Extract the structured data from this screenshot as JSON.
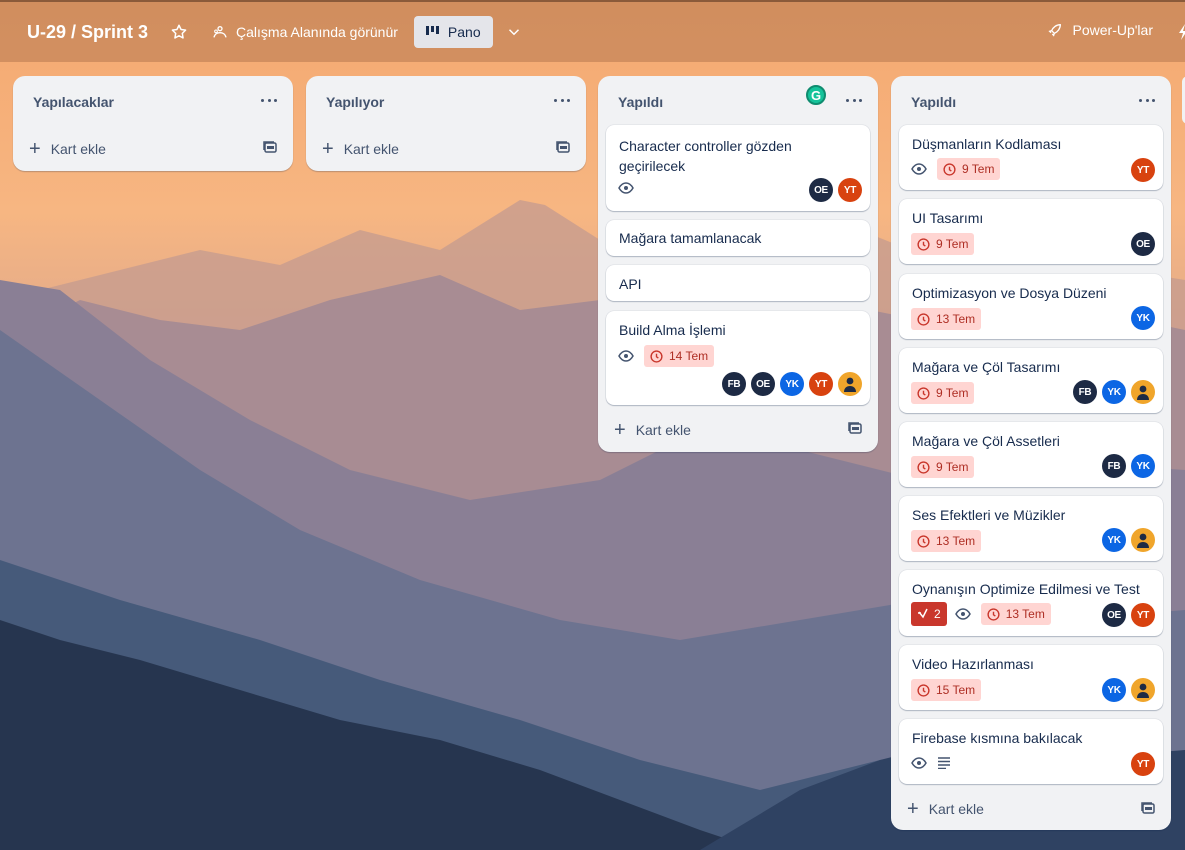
{
  "header": {
    "board_title": "U-29 / Sprint 3",
    "visibility_label": "Çalışma Alanında görünür",
    "view_label": "Pano",
    "powerups_label": "Power-Up'lar"
  },
  "add_card_label": "Kart ekle",
  "colors": {
    "due_bg": "#ffd5d2",
    "due_text": "#ae2e24",
    "checklist_bg": "#c9372c",
    "avatar_dark": "#1d2a44",
    "avatar_red": "#d8420f",
    "avatar_blue": "#0c66e4",
    "avatar_orange": "#f0a52b"
  },
  "lists": [
    {
      "title": "Yapılacaklar",
      "cards": []
    },
    {
      "title": "Yapılıyor",
      "cards": []
    },
    {
      "title": "Yapıldı",
      "grammarly_badge": "G",
      "cards": [
        {
          "title": "Character controller gözden geçirilecek",
          "watch": true,
          "members": [
            "OE",
            "YT"
          ]
        },
        {
          "title": "Mağara tamamlanacak"
        },
        {
          "title": "API"
        },
        {
          "title": "Build Alma İşlemi",
          "watch": true,
          "due": "14 Tem",
          "members": [
            "FB",
            "OE",
            "YK",
            "YT",
            "user-avatar"
          ]
        }
      ]
    },
    {
      "title": "Yapıldı",
      "cards": [
        {
          "title": "Düşmanların Kodlaması",
          "watch": true,
          "due": "9 Tem",
          "members": [
            "YT"
          ]
        },
        {
          "title": "UI Tasarımı",
          "due": "9 Tem",
          "members": [
            "OE"
          ]
        },
        {
          "title": "Optimizasyon ve Dosya Düzeni",
          "due": "13 Tem",
          "members": [
            "YK"
          ]
        },
        {
          "title": "Mağara ve Çöl Tasarımı",
          "due": "9 Tem",
          "members": [
            "FB",
            "YK",
            "user-avatar"
          ]
        },
        {
          "title": "Mağara ve Çöl Assetleri",
          "due": "9 Tem",
          "members": [
            "FB",
            "YK"
          ]
        },
        {
          "title": "Ses Efektleri ve Müzikler",
          "due": "13 Tem",
          "members": [
            "YK",
            "user-avatar"
          ]
        },
        {
          "title": "Oynanışın Optimize Edilmesi ve Test",
          "checklist": "2",
          "watch": true,
          "due": "13 Tem",
          "members": [
            "OE",
            "YT"
          ]
        },
        {
          "title": "Video Hazırlanması",
          "due": "15 Tem",
          "members": [
            "YK",
            "user-avatar"
          ]
        },
        {
          "title": "Firebase kısmına bakılacak",
          "watch": true,
          "description": true,
          "members": [
            "YT"
          ]
        }
      ]
    }
  ]
}
